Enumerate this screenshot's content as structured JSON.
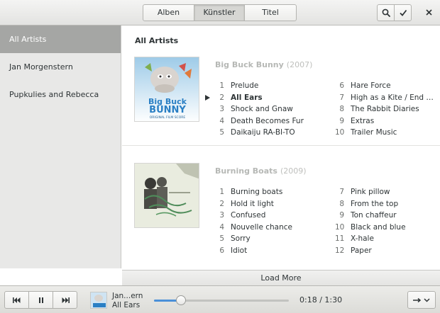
{
  "header": {
    "tabs": [
      {
        "label": "Alben",
        "active": false
      },
      {
        "label": "Künstler",
        "active": true
      },
      {
        "label": "Titel",
        "active": false
      }
    ],
    "search_icon": "search-icon",
    "select_icon": "check-icon",
    "close_icon": "close-icon"
  },
  "sidebar": {
    "items": [
      {
        "label": "All Artists",
        "active": true
      },
      {
        "label": "Jan Morgenstern",
        "active": false
      },
      {
        "label": "Pupkulies and Rebecca",
        "active": false
      }
    ]
  },
  "main": {
    "title": "All Artists",
    "albums": [
      {
        "title": "Big Buck Bunny",
        "year": "(2007)",
        "cover_text": [
          "Big Buck",
          "BUNNY",
          "ORIGINAL FILM SCORE"
        ],
        "tracks": [
          {
            "num": "1",
            "name": "Prelude"
          },
          {
            "num": "2",
            "name": "All Ears"
          },
          {
            "num": "3",
            "name": "Shock and Gnaw"
          },
          {
            "num": "4",
            "name": "Death Becomes Fur"
          },
          {
            "num": "5",
            "name": "Daikaiju RA-BI-TO"
          },
          {
            "num": "6",
            "name": "Hare Force"
          },
          {
            "num": "7",
            "name": "High as a Kite / End Cra..."
          },
          {
            "num": "8",
            "name": "The Rabbit Diaries"
          },
          {
            "num": "9",
            "name": "Extras"
          },
          {
            "num": "10",
            "name": "Trailer Music"
          }
        ]
      },
      {
        "title": "Burning Boats",
        "year": "(2009)",
        "tracks": [
          {
            "num": "1",
            "name": "Burning boats"
          },
          {
            "num": "2",
            "name": "Hold it light"
          },
          {
            "num": "3",
            "name": "Confused"
          },
          {
            "num": "4",
            "name": "Nouvelle chance"
          },
          {
            "num": "5",
            "name": "Sorry"
          },
          {
            "num": "6",
            "name": "Idiot"
          },
          {
            "num": "7",
            "name": "Pink pillow"
          },
          {
            "num": "8",
            "name": "From the top"
          },
          {
            "num": "9",
            "name": "Ton chaffeur"
          },
          {
            "num": "10",
            "name": "Black and blue"
          },
          {
            "num": "11",
            "name": "X-hale"
          },
          {
            "num": "12",
            "name": "Paper"
          }
        ]
      }
    ],
    "load_more": "Load More"
  },
  "player": {
    "prev_icon": "skip-back-icon",
    "pause_icon": "pause-icon",
    "next_icon": "skip-forward-icon",
    "now_artist": "Jan...ern",
    "now_track": "All Ears",
    "elapsed": "0:18",
    "separator": "/",
    "duration": "1:30",
    "progress_fraction": 0.2,
    "repeat_icon": "shuffle-arrow-icon",
    "accent_color": "#4a90d9"
  }
}
